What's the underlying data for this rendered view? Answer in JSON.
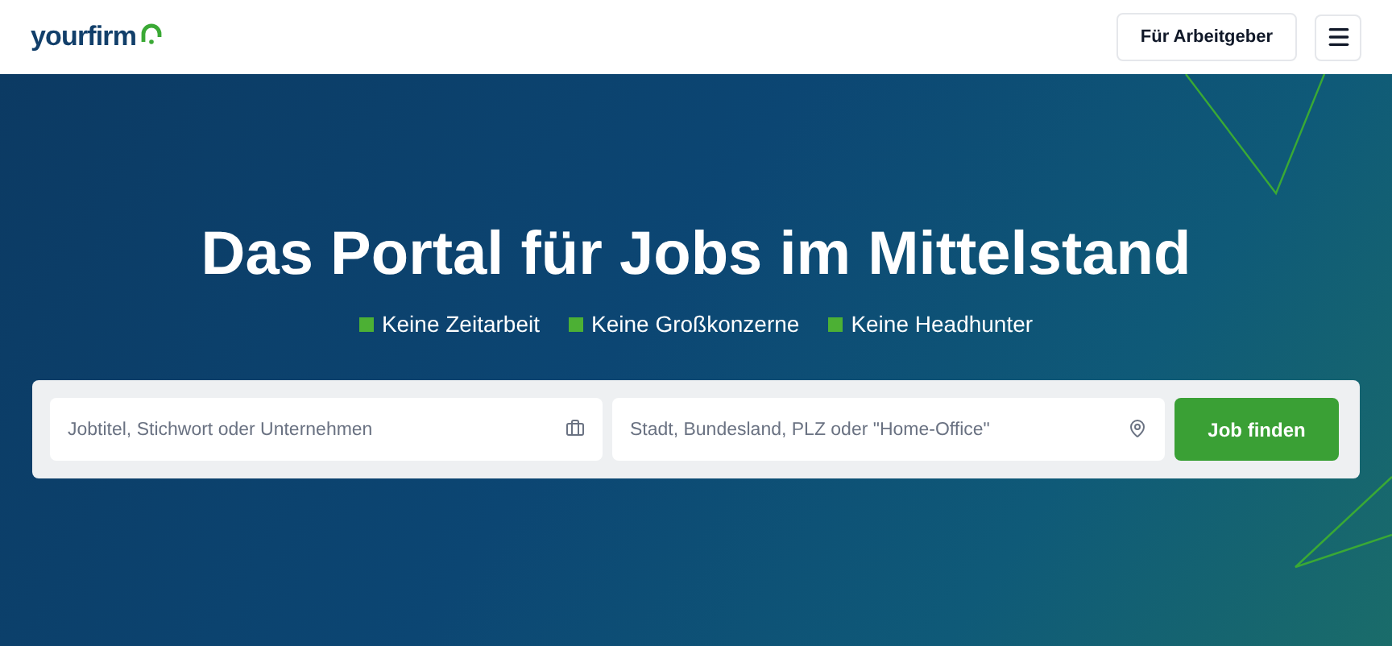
{
  "header": {
    "logo": "yourfirm",
    "employer_button": "Für Arbeitgeber"
  },
  "hero": {
    "title": "Das Portal für Jobs im Mittelstand",
    "benefits": [
      "Keine Zeitarbeit",
      "Keine Großkonzerne",
      "Keine Headhunter"
    ],
    "search": {
      "job_field": {
        "placeholder": "Jobtitel, Stichwort oder Unternehmen"
      },
      "location_field": {
        "placeholder": "Stadt, Bundesland, PLZ oder \"Home-Office\""
      },
      "button": "Job finden"
    }
  }
}
